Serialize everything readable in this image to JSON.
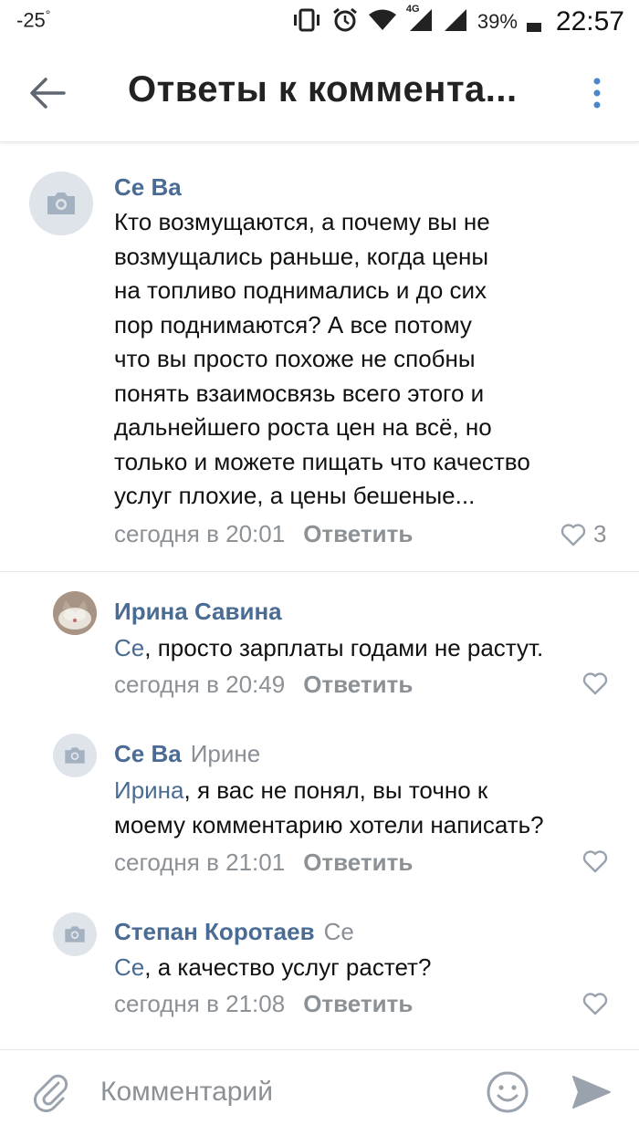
{
  "status_bar": {
    "temperature": "-25",
    "degree": "°",
    "network": "4G",
    "battery": "39%",
    "time": "22:57"
  },
  "header": {
    "title": "Ответы к коммента...",
    "back_icon": "arrow-left-icon",
    "more_icon": "more-vertical-icon"
  },
  "comments": [
    {
      "author": "Се Ва",
      "reply_to": "",
      "avatar": "camera-placeholder-icon",
      "mention": "",
      "text_lines": [
        "Кто возмущаются, а почему вы не",
        "возмущались раньше, когда цены",
        "на топливо поднимались и до сих",
        "пор поднимаются? А все потому",
        "что вы просто похоже не спобны",
        "понять взаимосвязь всего этого и",
        "дальнейшего роста цен на всё, но",
        "только и можете пищать что качество",
        "услуг плохие, а цены бешеные..."
      ],
      "time": "сегодня в 20:01",
      "reply_label": "Ответить",
      "likes": "3"
    },
    {
      "author": "Ирина Савина",
      "reply_to": "",
      "avatar": "cat-photo-avatar",
      "mention": "Се",
      "text": ", просто зарплаты годами не растут.",
      "time": "сегодня в 20:49",
      "reply_label": "Ответить",
      "likes": ""
    },
    {
      "author": "Се Ва",
      "reply_to": "Ирине",
      "avatar": "camera-placeholder-icon",
      "mention": "Ирина",
      "text_first": ", я вас не понял, вы точно к",
      "text_second": "моему комментарию хотели написать?",
      "time": "сегодня в 21:01",
      "reply_label": "Ответить",
      "likes": ""
    },
    {
      "author": "Степан Коротаев",
      "reply_to": "Се",
      "avatar": "camera-placeholder-icon",
      "mention": "Се",
      "text": ", а качество услуг растет?",
      "time": "сегодня в 21:08",
      "reply_label": "Ответить",
      "likes": ""
    }
  ],
  "composer": {
    "placeholder": "Комментарий",
    "attach_icon": "paperclip-icon",
    "emoji_icon": "smiley-icon",
    "send_icon": "send-icon"
  },
  "colors": {
    "accent": "#4a6c94",
    "secondary_text": "#8c9196",
    "avatar_bg": "#dfe4ea"
  }
}
